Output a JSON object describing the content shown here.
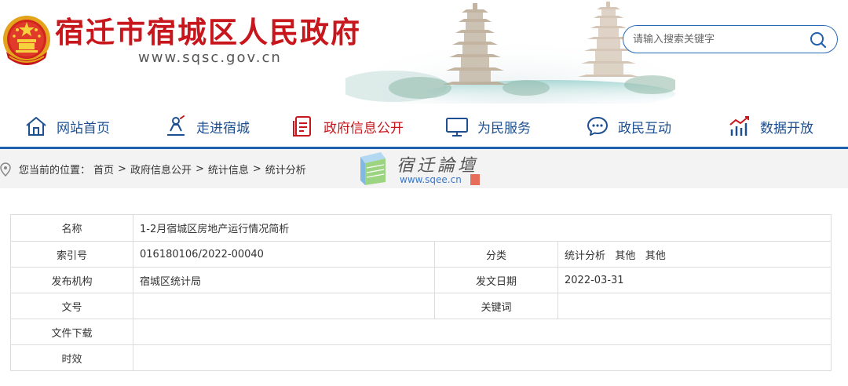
{
  "header": {
    "site_title": "宿迁市宿城区人民政府",
    "site_domain": "www.sqsc.gov.cn",
    "search_placeholder": "请输入搜索关键字"
  },
  "nav": {
    "items": [
      {
        "label": "网站首页",
        "icon": "home-icon"
      },
      {
        "label": "走进宿城",
        "icon": "person-icon"
      },
      {
        "label": "政府信息公开",
        "icon": "document-icon"
      },
      {
        "label": "为民服务",
        "icon": "monitor-icon"
      },
      {
        "label": "政民互动",
        "icon": "chat-icon"
      },
      {
        "label": "数据开放",
        "icon": "bar-chart-icon"
      }
    ]
  },
  "breadcrumb": {
    "prefix": "您当前的位置：",
    "items": [
      "首页",
      "政府信息公开",
      "统计信息",
      "统计分析"
    ],
    "separator": ">"
  },
  "watermark": {
    "title": "宿迁論壇",
    "url": "www.sqee.cn"
  },
  "info": {
    "name_label": "名称",
    "name_value": "1-2月宿城区房地产运行情况简析",
    "index_label": "索引号",
    "index_value": "016180106/2022-00040",
    "category_label": "分类",
    "category_value": "统计分析   其他   其他",
    "org_label": "发布机构",
    "org_value": "宿城区统计局",
    "date_label": "发文日期",
    "date_value": "2022-03-31",
    "docno_label": "文号",
    "docno_value": "",
    "keywords_label": "关键词",
    "keywords_value": "",
    "download_label": "文件下载",
    "download_value": "",
    "validity_label": "时效",
    "validity_value": ""
  },
  "colors": {
    "brand_red": "#c8161d",
    "nav_blue": "#1d4f91",
    "accent_blue": "#1e5fae"
  }
}
